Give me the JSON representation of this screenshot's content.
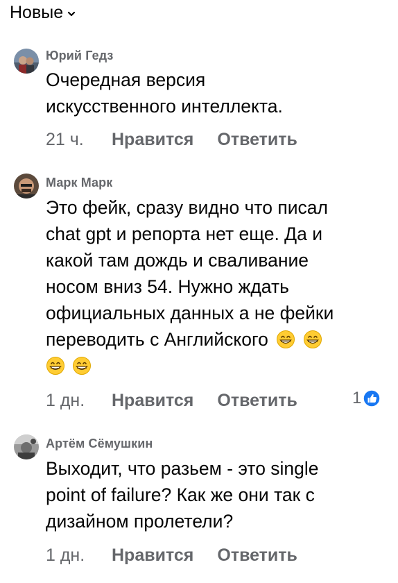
{
  "header": {
    "sort_label": "Новые"
  },
  "comments": [
    {
      "author": "Юрий Гедз",
      "text_lines": [
        "Очередная версия",
        "искусственного интеллекта."
      ],
      "time": "21 ч.",
      "like_label": "Нравится",
      "reply_label": "Ответить"
    },
    {
      "author": "Марк Марк",
      "text_lines": [
        "Это фейк, сразу видно что писал",
        "chat gpt и репорта нет еще. Да и",
        "какой там дождь и сваливание",
        "носом вниз 54. Нужно ждать",
        "официальных данных а не фейки",
        "переводить с Английского"
      ],
      "emoji_name": "grinning-face-emoji",
      "time": "1 дн.",
      "like_label": "Нравится",
      "reply_label": "Ответить",
      "reaction_count": "1",
      "reaction_icon": "like-icon"
    },
    {
      "author": "Артём Сёмушкин",
      "text_lines": [
        "Выходит, что разьем - это single",
        "point of failure? Как же они так с",
        "дизайном пролетели?"
      ],
      "time": "1 дн.",
      "like_label": "Нравится",
      "reply_label": "Ответить"
    }
  ],
  "colors": {
    "text": "#050505",
    "secondary": "#65676b",
    "like_blue": "#1877f2",
    "emoji_yellow": "#ffcc33"
  }
}
